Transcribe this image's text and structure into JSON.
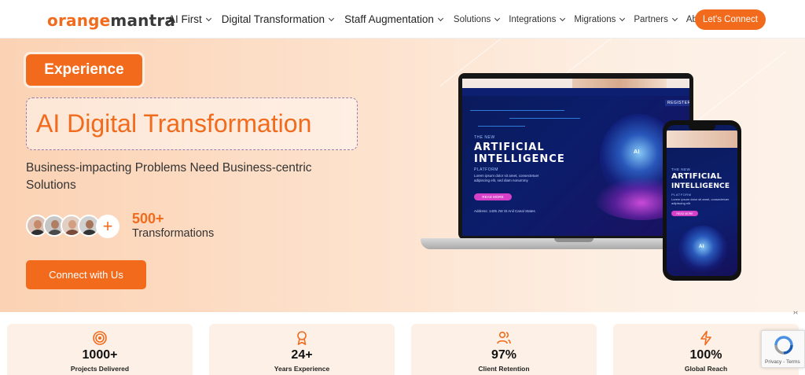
{
  "header": {
    "logo_part1": "orange",
    "logo_part2": "mantra",
    "nav_main": [
      {
        "label": "AI First",
        "name": "nav-ai-first"
      },
      {
        "label": "Digital Transformation",
        "name": "nav-digital-transformation"
      },
      {
        "label": "Staff Augmentation",
        "name": "nav-staff-augmentation"
      }
    ],
    "nav_secondary": [
      {
        "label": "Solutions",
        "name": "nav-solutions"
      },
      {
        "label": "Integrations",
        "name": "nav-integrations"
      },
      {
        "label": "Migrations",
        "name": "nav-migrations"
      },
      {
        "label": "Partners",
        "name": "nav-partners"
      },
      {
        "label": "About Us",
        "name": "nav-about-us"
      }
    ],
    "cta_label": "Let's Connect"
  },
  "hero": {
    "badge": "Experience",
    "title": "AI Digital Transformation",
    "subtitle": "Business-impacting Problems Need Business-centric Solutions",
    "plus": "+",
    "count_value": "500+",
    "count_label": "Transformations",
    "connect_label": "Connect with Us"
  },
  "mockup": {
    "laptop": {
      "kicker": "THE NEW",
      "headline_1": "ARTIFICIAL",
      "headline_2": "INTELLIGENCE",
      "platform": "PLATFORM",
      "paragraph": "Lorem ipsum dolor sit amet, consectetuer adipiscing elit, sed diam nonummy",
      "button": "READ MORE",
      "address": "Address: 1405 JW St Anil Canal States",
      "corner_text": "REGISTER",
      "brain_label": "AI"
    },
    "phone": {
      "kicker": "THE NEW",
      "headline_1": "ARTIFICIAL",
      "headline_2": "INTELLIGENCE",
      "platform": "PLATFORM",
      "paragraph": "Lorem ipsum dolor sit amet, consectetuer adipiscing elit",
      "button": "READ MORE",
      "brain_label": "AI"
    }
  },
  "stats": [
    {
      "value": "1000+",
      "label": "Projects Delivered",
      "icon": "target-icon"
    },
    {
      "value": "24+",
      "label": "Years Experience",
      "icon": "award-icon"
    },
    {
      "value": "97%",
      "label": "Client Retention",
      "icon": "users-icon"
    },
    {
      "value": "100%",
      "label": "Global Reach",
      "icon": "lightning-icon"
    }
  ],
  "recaptcha": {
    "links": "Privacy - Terms"
  },
  "colors": {
    "accent": "#f26b1d",
    "hero_bg": "#fde2cd",
    "card_bg": "#fdf1e7"
  }
}
